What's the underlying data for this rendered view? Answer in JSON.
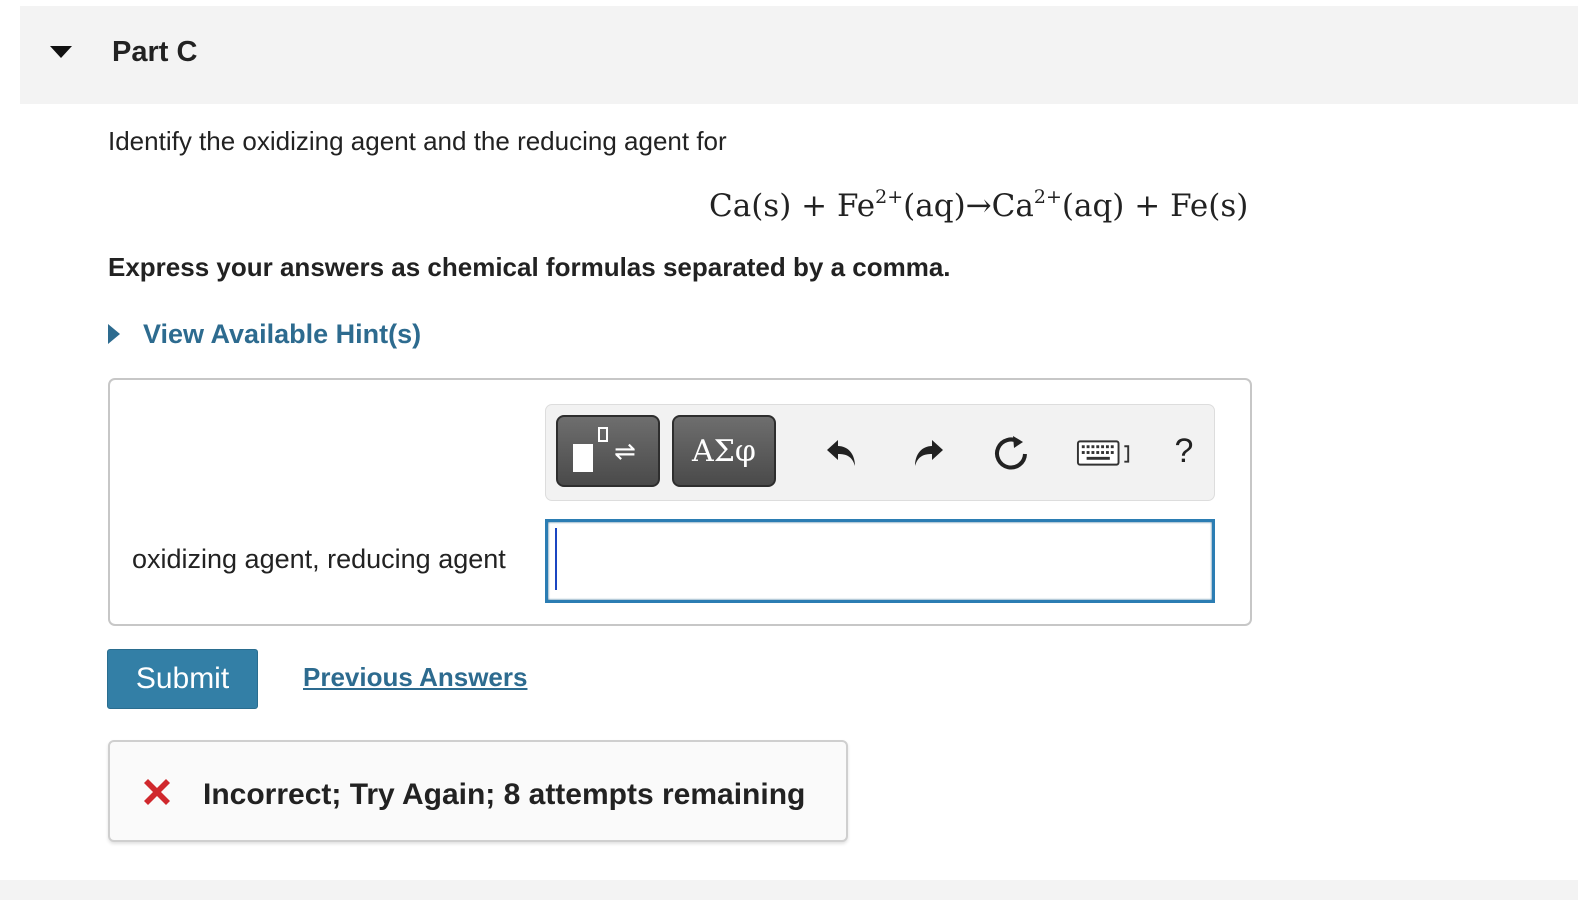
{
  "part": {
    "title": "Part C"
  },
  "question": {
    "prompt": "Identify the oxidizing agent and the reducing agent for",
    "equation": {
      "segments": [
        {
          "text": "Ca(s) + Fe"
        },
        {
          "sup": "2+"
        },
        {
          "text": "(aq)→Ca"
        },
        {
          "sup": "2+"
        },
        {
          "text": "(aq) + Fe(s)"
        }
      ]
    },
    "instructions": "Express your answers as chemical formulas separated by a comma."
  },
  "hint": {
    "label": "View Available Hint(s)"
  },
  "toolbar": {
    "symbols_label": "ΑΣφ",
    "help_label": "?",
    "icons": [
      "templates-icon",
      "symbols-icon",
      "undo-icon",
      "redo-icon",
      "reset-icon",
      "keyboard-icon",
      "help-icon"
    ]
  },
  "answer": {
    "label": "oxidizing agent, reducing agent",
    "value": ""
  },
  "actions": {
    "submit_label": "Submit",
    "previous_answers_label": "Previous Answers"
  },
  "feedback": {
    "text": "Incorrect; Try Again; 8 attempts remaining",
    "status": "incorrect"
  },
  "colors": {
    "accent": "#337fa6",
    "link": "#2d6b8f",
    "error": "#d0282d",
    "header_bg": "#f3f3f3"
  }
}
